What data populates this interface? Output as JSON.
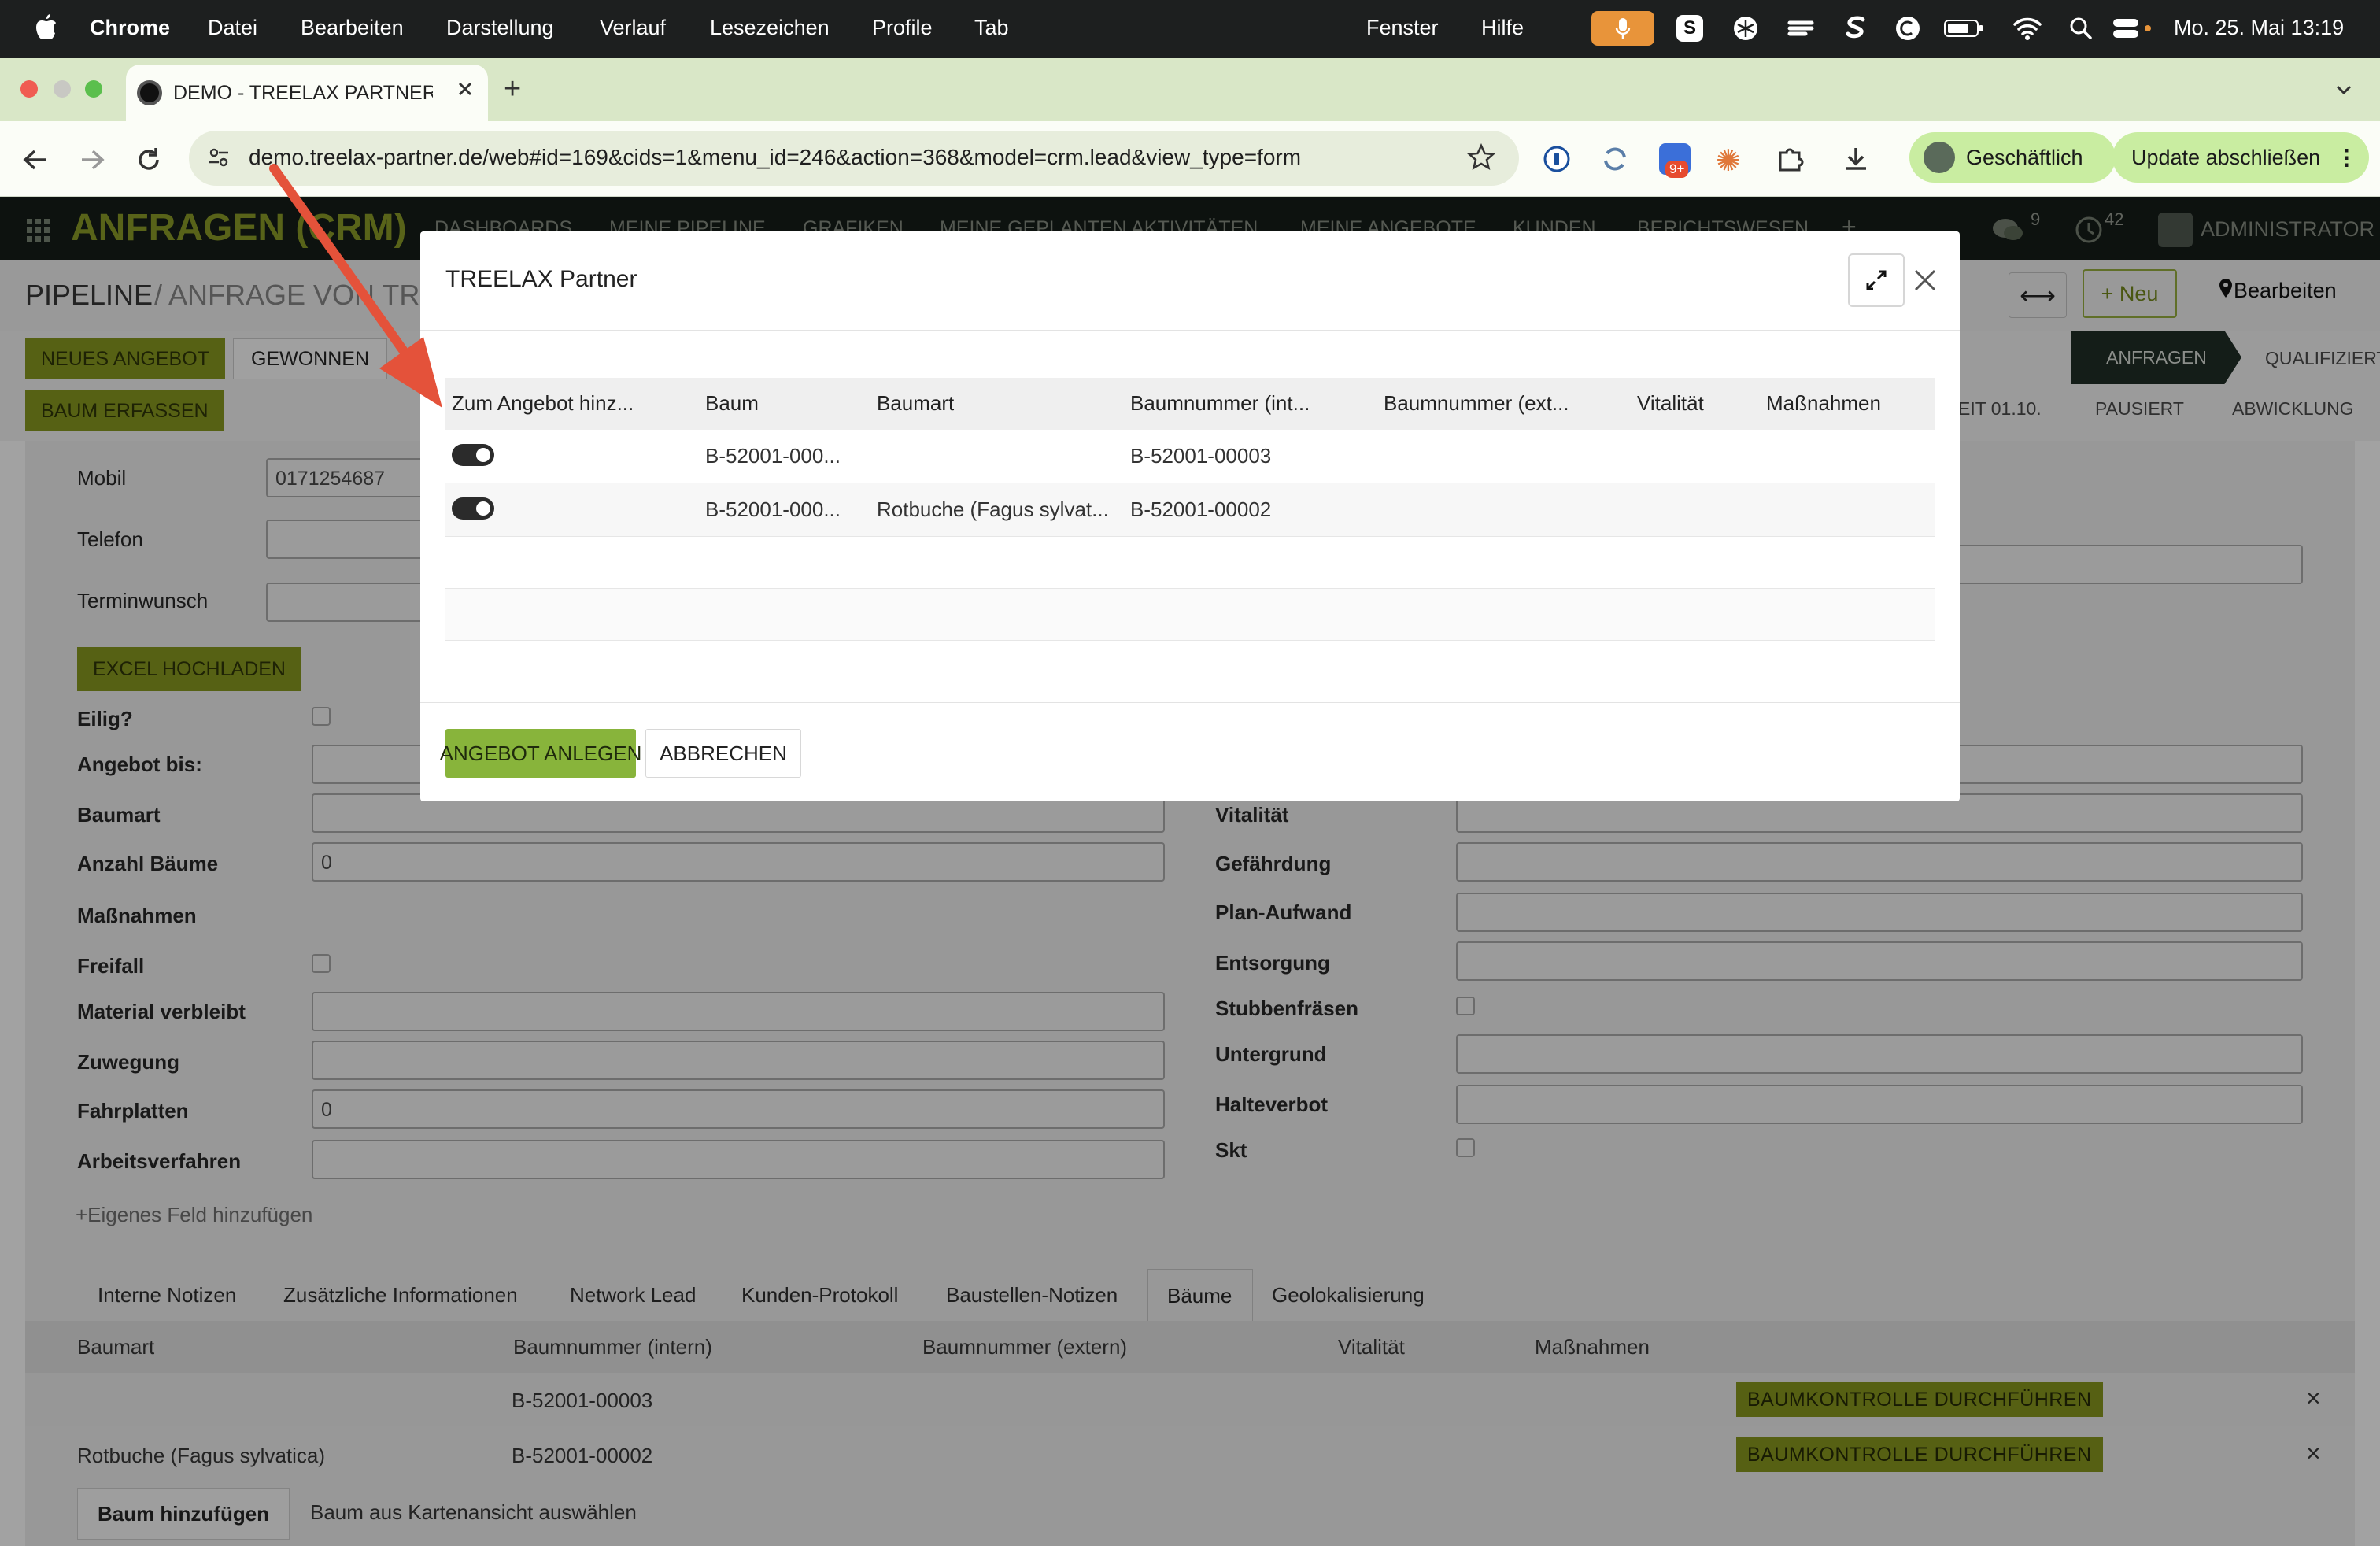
{
  "macos": {
    "app": "Chrome",
    "menus": [
      "Datei",
      "Bearbeiten",
      "Darstellung",
      "Verlauf",
      "Lesezeichen",
      "Profile",
      "Tab",
      "Fenster",
      "Hilfe"
    ],
    "clock": "Mo. 25. Mai  13:19"
  },
  "browser": {
    "tab_title": "DEMO - TREELAX PARTNER - ",
    "new_tab": "+",
    "url": "demo.treelax-partner.de/web#id=169&cids=1&menu_id=246&action=368&model=crm.lead&view_type=form",
    "profile_label": "Geschäftlich",
    "update_label": "Update abschließen",
    "extension_badge": "9+"
  },
  "odoo": {
    "app_title": "ANFRAGEN (CRM)",
    "menu": [
      "DASHBOARDS",
      "MEINE PIPELINE",
      "GRAFIKEN",
      "MEINE GEPLANTEN AKTIVITÄTEN",
      "MEINE ANGEBOTE",
      "KUNDEN",
      "BERICHTSWESEN",
      "+"
    ],
    "chat_count": "9",
    "activity_count": "42",
    "user": "ADMINISTRATOR",
    "breadcrumb_root": "PIPELINE",
    "breadcrumb_current": "/ ANFRAGE VON TRIS",
    "new_label": "+ Neu",
    "edit_label": "Bearbeiten",
    "buttons": {
      "new_offer": "NEUES ANGEBOT",
      "won": "GEWONNEN",
      "record_tree": "BAUM ERFASSEN",
      "excel": "EXCEL HOCHLADEN"
    },
    "stages": [
      "ANFRAGEN",
      "QUALIFIZIERT",
      "EIT 01.10.",
      "PAUSIERT",
      "ABWICKLUNG"
    ]
  },
  "form": {
    "mobil_label": "Mobil",
    "mobil_value": "0171254687",
    "telefon_label": "Telefon",
    "termin_label": "Terminwunsch",
    "eilig_label": "Eilig?",
    "angebot_bis_label": "Angebot bis:",
    "baumart_label": "Baumart",
    "anzahl_label": "Anzahl Bäume",
    "anzahl_value": "0",
    "massnahmen_label": "Maßnahmen",
    "freifall_label": "Freifall",
    "material_label": "Material verbleibt",
    "zuwegung_label": "Zuwegung",
    "fahrplatten_label": "Fahrplatten",
    "fahrplatten_value": "0",
    "arbeitsverfahren_label": "Arbeitsverfahren",
    "eigenes_feld": "+Eigenes Feld hinzufügen",
    "vitalitaet_label": "Vitalität",
    "gefaehrdung_label": "Gefährdung",
    "plan_aufwand_label": "Plan-Aufwand",
    "entsorgung_label": "Entsorgung",
    "stubben_label": "Stubbenfräsen",
    "untergrund_label": "Untergrund",
    "halteverbot_label": "Halteverbot",
    "skt_label": "Skt"
  },
  "notebook": {
    "tabs": [
      "Interne Notizen",
      "Zusätzliche Informationen",
      "Network Lead",
      "Kunden-Protokoll",
      "Baustellen-Notizen",
      "Bäume",
      "Geolokalisierung"
    ],
    "columns": [
      "Baumart",
      "Baumnummer (intern)",
      "Baumnummer (extern)",
      "Vitalität",
      "Maßnahmen"
    ],
    "rows": [
      {
        "baumart": "",
        "intern": "B-52001-00003",
        "action": "BAUMKONTROLLE DURCHFÜHREN",
        "remove": "×"
      },
      {
        "baumart": "Rotbuche (Fagus sylvatica)",
        "intern": "B-52001-00002",
        "action": "BAUMKONTROLLE DURCHFÜHREN",
        "remove": "×"
      }
    ],
    "add_tree": "Baum hinzufügen",
    "select_from_map": "Baum aus Kartenansicht auswählen"
  },
  "modal": {
    "title": "TREELAX Partner",
    "columns": [
      "Zum Angebot hinz...",
      "Baum",
      "Baumart",
      "Baumnummer (int...",
      "Baumnummer (ext...",
      "Vitalität",
      "Maßnahmen"
    ],
    "rows": [
      {
        "toggle": true,
        "baum": "B-52001-000...",
        "baumart": "",
        "intern": "B-52001-00003"
      },
      {
        "toggle": true,
        "baum": "B-52001-000...",
        "baumart": "Rotbuche (Fagus sylvat...",
        "intern": "B-52001-00002"
      }
    ],
    "confirm": "ANGEBOT ANLEGEN",
    "cancel": "ABBRECHEN"
  },
  "colors": {
    "odoo_green": "#93a62a",
    "modal_button": "#88b43b",
    "annotation_arrow": "#e4523a",
    "chrome_update": "#c9eda1"
  }
}
